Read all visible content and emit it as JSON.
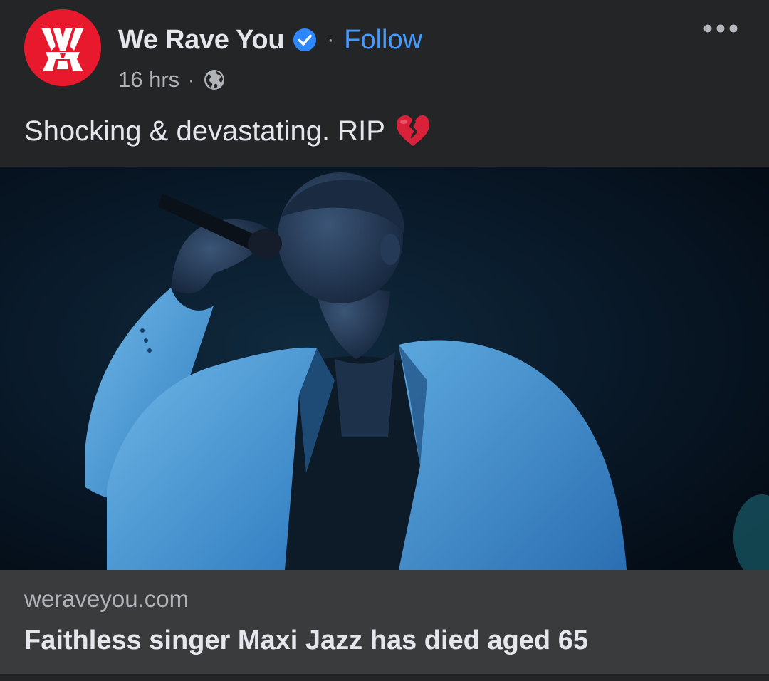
{
  "post": {
    "page_name": "We Rave You",
    "separator": "·",
    "follow_label": "Follow",
    "time": "16 hrs",
    "meta_separator": "·",
    "caption": "Shocking & devastating. RIP",
    "avatar_icon": "we-rave-you-logo",
    "verified_icon": "verified-badge-icon",
    "privacy_icon": "globe-icon",
    "caption_emoji": "broken-heart-emoji",
    "more_icon": "more-options-icon"
  },
  "link_preview": {
    "domain": "weraveyou.com",
    "headline": "Faithless singer Maxi Jazz has died aged 65"
  },
  "colors": {
    "background": "#242526",
    "link_box": "#3a3b3c",
    "primary_text": "#e4e6eb",
    "secondary_text": "#b0b3b8",
    "follow_blue": "#4599ff",
    "verified_blue": "#2d88ff",
    "avatar_red": "#e8192c"
  }
}
